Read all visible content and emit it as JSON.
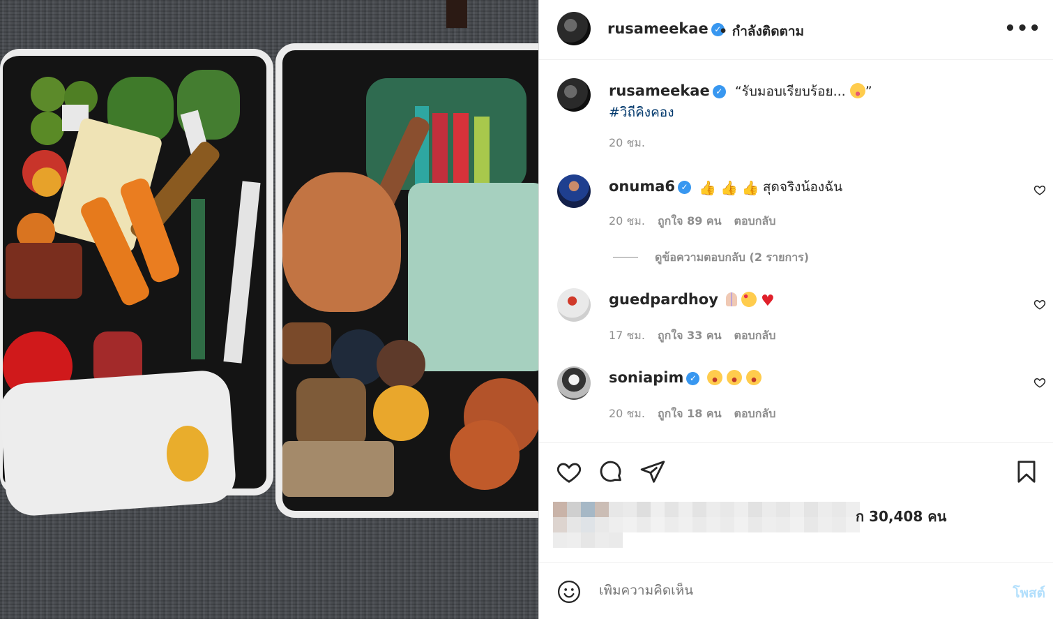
{
  "post": {
    "author": "rusameekae",
    "follow_status": "• กำลังติดตาม",
    "more_label": "•••",
    "caption": "“รับมอบเรียบร้อย...",
    "caption_end": "”",
    "hashtag": "#วิถีคิงคอง",
    "caption_time": "20 ชม.",
    "image_alt": "Two open suitcases filled with Thai groceries"
  },
  "comments": [
    {
      "user": "onuma6",
      "verified": true,
      "text": "สุดจริงน้องฉัน",
      "time": "20 ชม.",
      "likes": "ถูกใจ 89 คน",
      "reply": "ตอบกลับ"
    },
    {
      "user": "guedpardhoy",
      "verified": false,
      "text": "",
      "time": "17 ชม.",
      "likes": "ถูกใจ 33 คน",
      "reply": "ตอบกลับ"
    },
    {
      "user": "soniapim",
      "verified": true,
      "text": "",
      "time": "20 ชม.",
      "likes": "ถูกใจ 18 คน",
      "reply": "ตอบกลับ"
    }
  ],
  "view_replies": "ดูข้อความตอบกลับ (2 รายการ)",
  "likes_summary": "ก 30,408 คน",
  "comment_box": {
    "placeholder": "เพิ่มความคิดเห็น",
    "post_label": "โพสต์"
  },
  "colors": {
    "link": "#00376b",
    "verified": "#3897f0",
    "muted": "#8e8e8e",
    "post_disabled": "#b2dffc"
  },
  "icons": [
    "heart-icon",
    "comment-icon",
    "share-icon",
    "bookmark-icon",
    "emoji-icon",
    "verified-badge-icon"
  ]
}
